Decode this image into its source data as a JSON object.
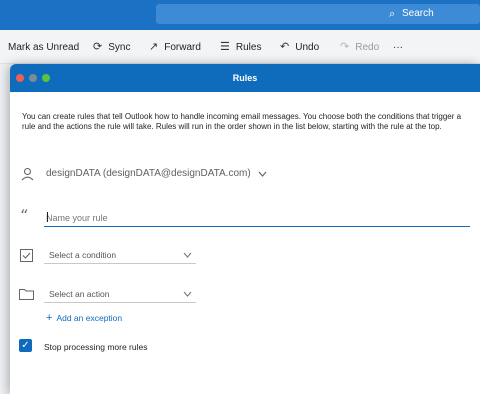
{
  "search": {
    "label": "Search",
    "icon": "search-icon"
  },
  "toolbar": {
    "items": [
      {
        "label": "Mark as Unread",
        "icon": "envelope-icon"
      },
      {
        "label": "Sync",
        "icon": "sync-icon"
      },
      {
        "label": "Forward",
        "icon": "forward-arrow-icon"
      },
      {
        "label": "Rules",
        "icon": "rules-list-icon"
      },
      {
        "label": "Undo",
        "icon": "undo-icon"
      },
      {
        "label": "Redo",
        "icon": "redo-icon",
        "disabled": true
      }
    ],
    "more_glyph": "···"
  },
  "dialog": {
    "title": "Rules",
    "intro": "You can create rules that tell Outlook how to handle incoming email messages. You choose both the conditions that trigger a rule and the actions the rule will take. Rules will run in the order shown in the list below, starting with the rule at the top.",
    "account": "designDATA (designDATA@designDATA.com)",
    "name_placeholder": "Name your rule",
    "condition_placeholder": "Select a condition",
    "action_placeholder": "Select an action",
    "exception_label": "Add an exception",
    "stop_label": "Stop processing more rules",
    "stop_checked": true
  },
  "colors": {
    "accent": "#0f6cbd",
    "topbar": "#1b72c5"
  }
}
